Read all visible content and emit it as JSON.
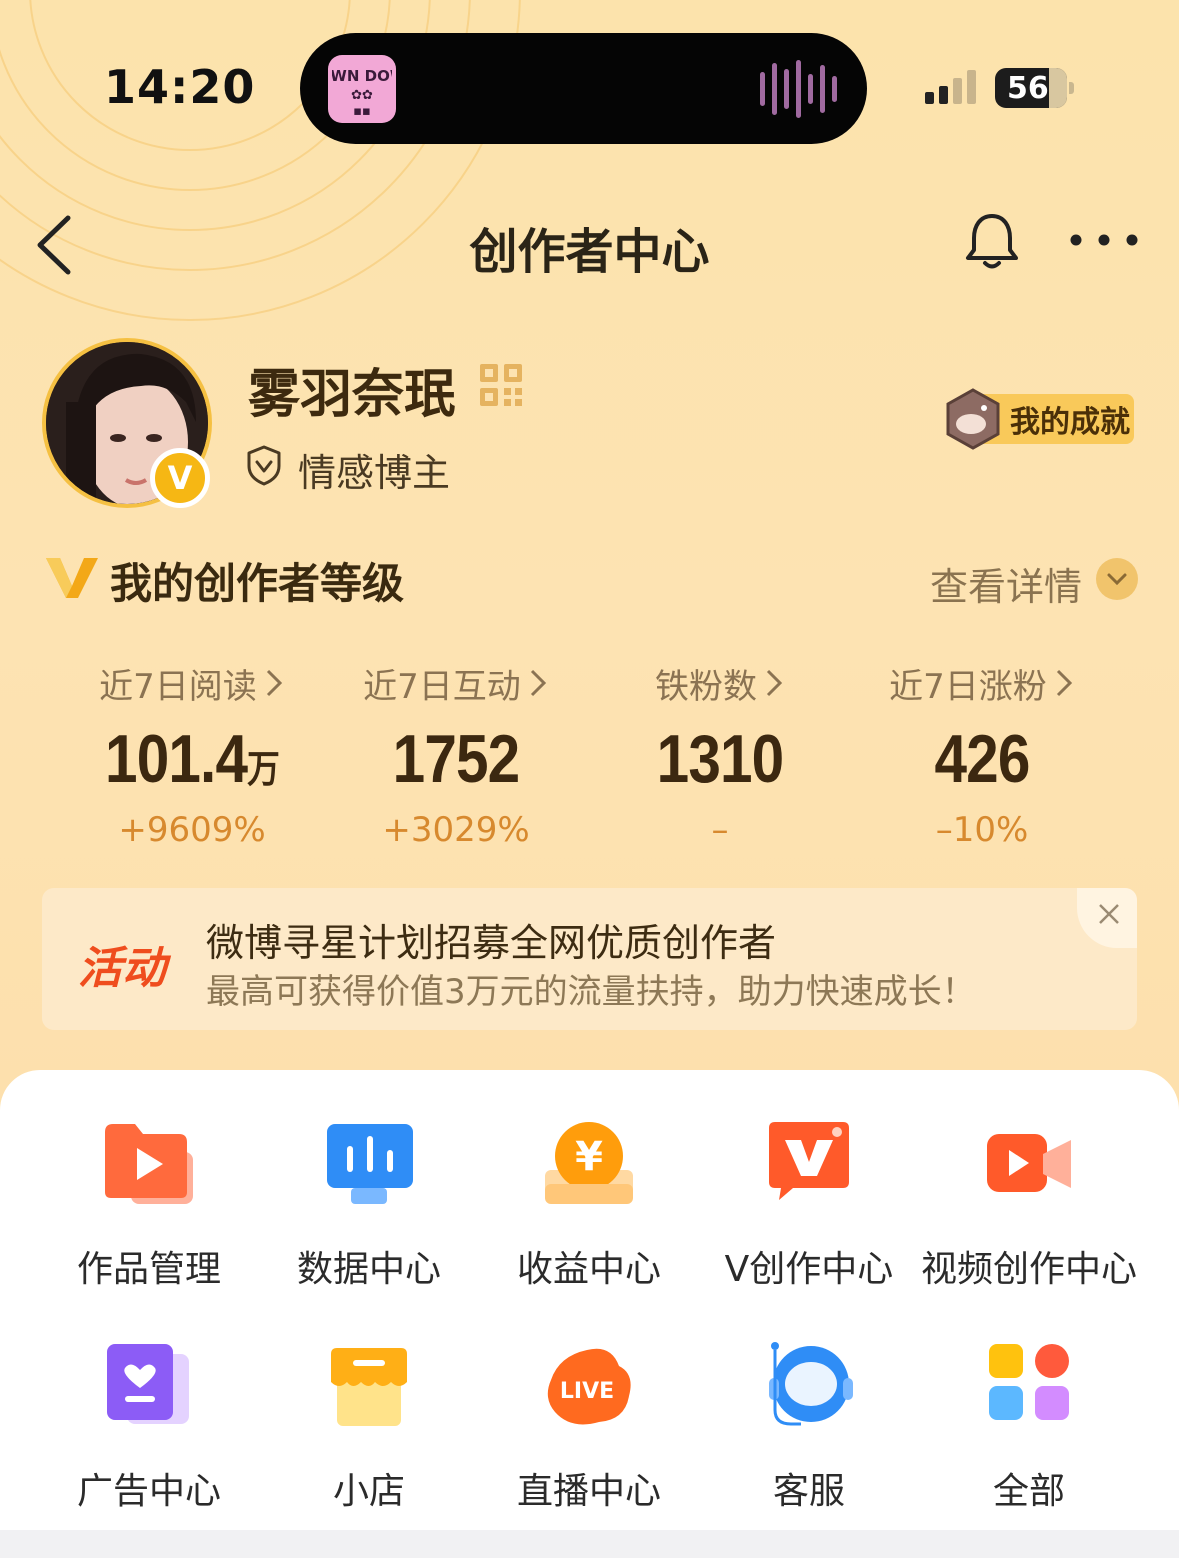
{
  "status_bar": {
    "time": "14:20",
    "battery": "56",
    "island_app": "DOWN DOWN"
  },
  "nav": {
    "title": "创作者中心"
  },
  "profile": {
    "username": "雾羽奈珉",
    "tag": "情感博主",
    "verified_badge": "V",
    "achievement_label": "我的成就"
  },
  "level": {
    "title": "我的创作者等级",
    "detail_link": "查看详情"
  },
  "stats": [
    {
      "label": "近7日阅读",
      "value": "101.4",
      "unit": "万",
      "change": "+9609%"
    },
    {
      "label": "近7日互动",
      "value": "1752",
      "unit": "",
      "change": "+3029%"
    },
    {
      "label": "铁粉数",
      "value": "1310",
      "unit": "",
      "change": "–"
    },
    {
      "label": "近7日涨粉",
      "value": "426",
      "unit": "",
      "change": "–10%"
    }
  ],
  "activity": {
    "tag": "活动",
    "title": "微博寻星计划招募全网优质创作者",
    "subtitle": "最高可获得价值3万元的流量扶持，助力快速成长！"
  },
  "tools": [
    {
      "label": "作品管理",
      "icon": "folder-play-icon"
    },
    {
      "label": "数据中心",
      "icon": "monitor-chart-icon"
    },
    {
      "label": "收益中心",
      "icon": "yuan-coin-icon"
    },
    {
      "label": "V创作中心",
      "icon": "v-creator-icon"
    },
    {
      "label": "视频创作中心",
      "icon": "video-camera-icon"
    },
    {
      "label": "广告中心",
      "icon": "ad-book-icon"
    },
    {
      "label": "小店",
      "icon": "shop-icon"
    },
    {
      "label": "直播中心",
      "icon": "live-icon"
    },
    {
      "label": "客服",
      "icon": "customer-service-icon"
    },
    {
      "label": "全部",
      "icon": "all-grid-icon"
    }
  ],
  "colors": {
    "accent": "#f6b714",
    "orange": "#ef4d1e",
    "change": "#d7892e"
  }
}
